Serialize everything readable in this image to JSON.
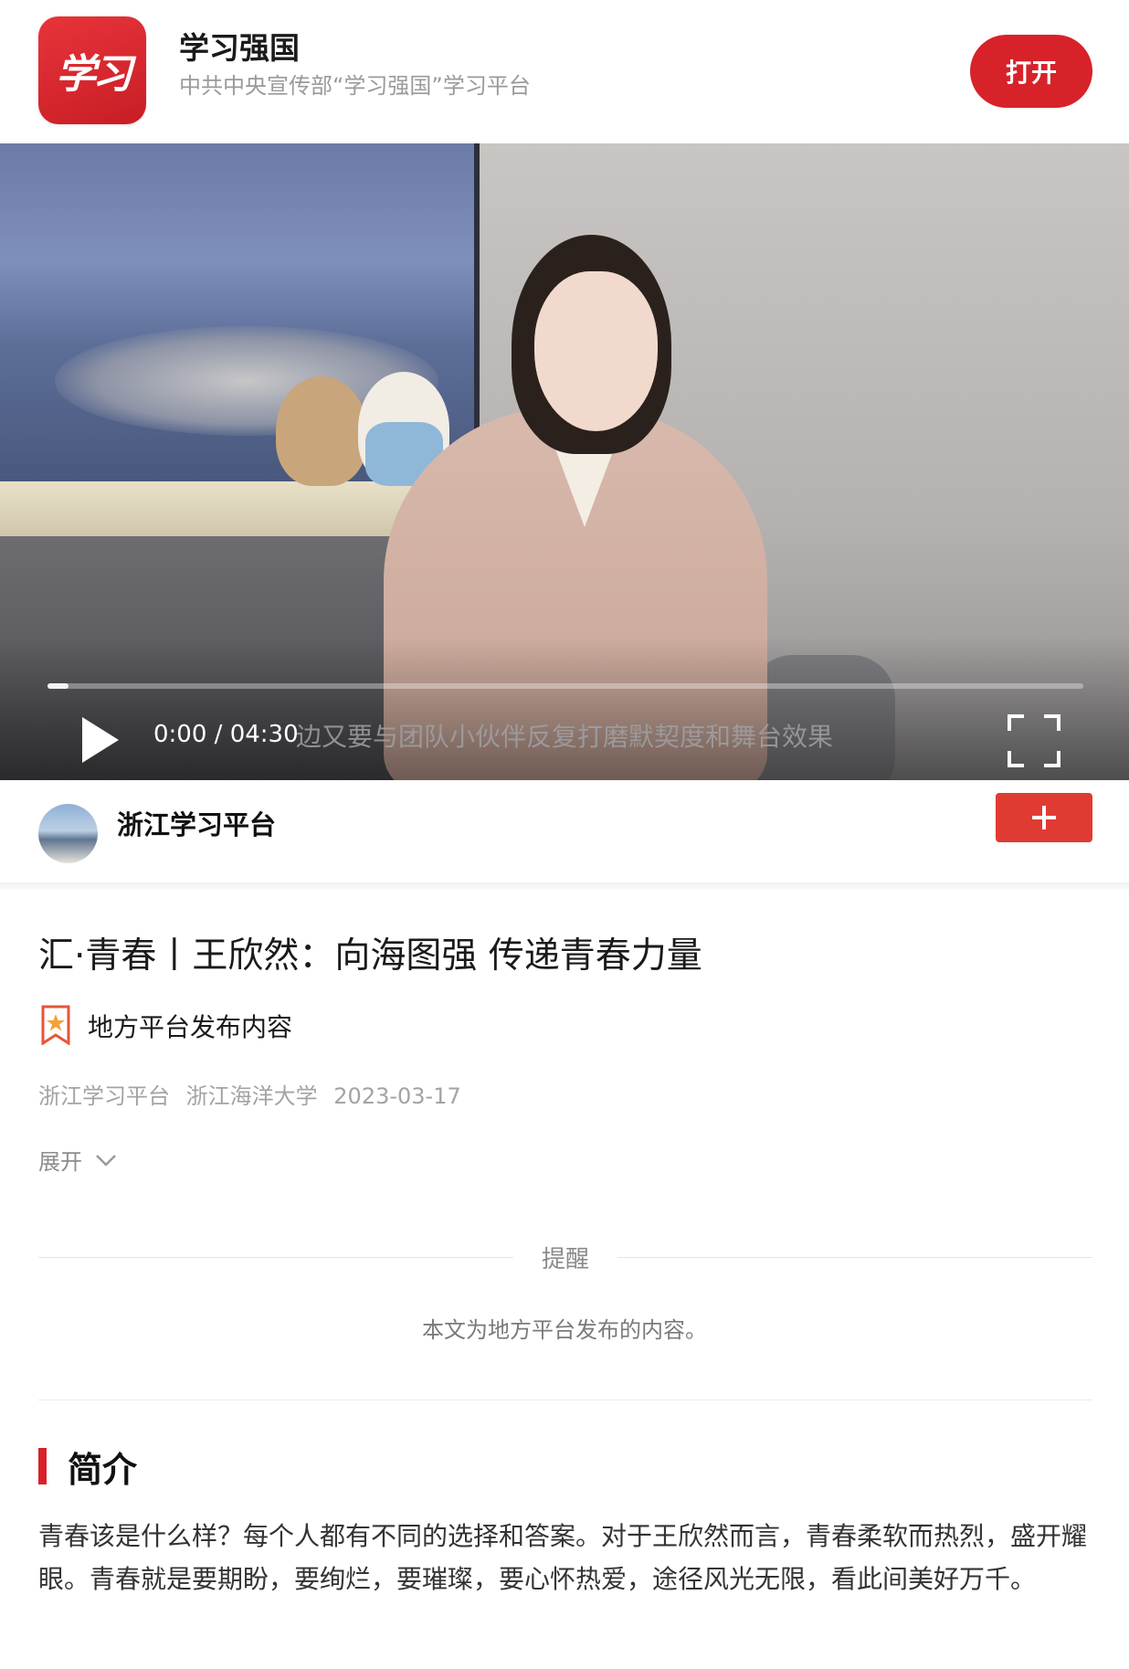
{
  "banner": {
    "app_logo_text": "学习",
    "app_name": "学习强国",
    "app_description": "中共中央宣传部“学习强国”学习平台",
    "open_button": "打开"
  },
  "video": {
    "current_time": "0:00",
    "separator": "/",
    "duration": "04:30",
    "subtitle": "边又要与团队小伙伴反复打磨默契度和舞台效果",
    "progress": 0.02,
    "icons": {
      "play": "play-icon",
      "fullscreen": "fullscreen-icon"
    }
  },
  "publisher": {
    "name": "浙江学习平台",
    "follow_icon": "plus-icon",
    "follow_color": "#e03b33"
  },
  "article": {
    "title": "汇·青春丨王欣然：向海图强 传递青春力量",
    "badge": "地方平台发布内容",
    "meta": {
      "source": "浙江学习平台",
      "author": "浙江海洋大学",
      "date": "2023-03-17"
    },
    "expand_label": "展开"
  },
  "reminder": {
    "title": "提醒",
    "text": "本文为地方平台发布的内容。"
  },
  "intro": {
    "heading": "简介",
    "text": "青春该是什么样？每个人都有不同的选择和答案。对于王欣然而言，青春柔软而热烈，盛开耀眼。青春就是要期盼，要绚烂，要璀璨，要心怀热爱，途径风光无限，看此间美好万千。"
  },
  "colors": {
    "accent": "#d7222a",
    "meta_text": "#a3a3a3"
  }
}
